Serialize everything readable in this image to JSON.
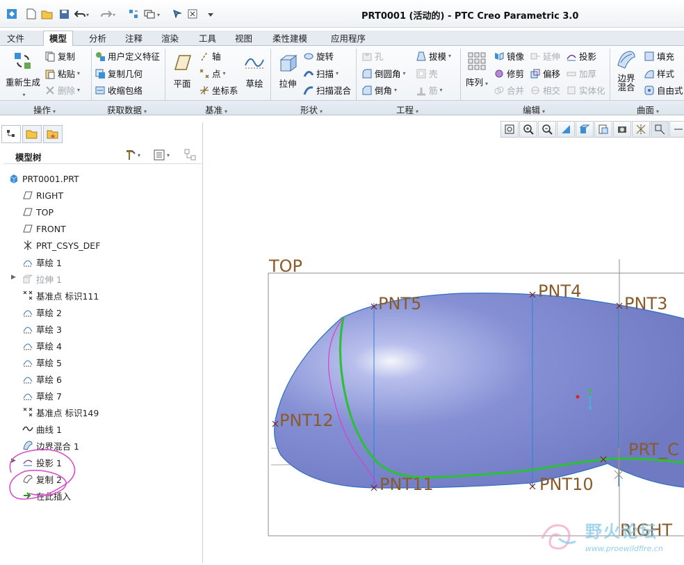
{
  "window": {
    "title": "PRT0001 (活动的) - PTC Creo Parametric 3.0"
  },
  "tabs": [
    {
      "label": "文件"
    },
    {
      "label": "模型"
    },
    {
      "label": "分析"
    },
    {
      "label": "注释"
    },
    {
      "label": "渲染"
    },
    {
      "label": "工具"
    },
    {
      "label": "视图"
    },
    {
      "label": "柔性建模"
    },
    {
      "label": "应用程序"
    }
  ],
  "ribbon": {
    "regenerate": "重新生成",
    "copy": "复制",
    "paste": "粘贴",
    "delete": "删除",
    "udf": "用户定义特征",
    "copy_geometry": "复制几何",
    "shrinkwrap": "收缩包络",
    "plane": "平面",
    "axis": "轴",
    "point": "点",
    "csys": "坐标系",
    "sketch": "草绘",
    "extrude": "拉伸",
    "revolve": "旋转",
    "sweep": "扫描",
    "swept_blend": "扫描混合",
    "hole": "孔",
    "round": "倒圆角",
    "chamfer": "倒角",
    "draft": "拔模",
    "shell": "壳",
    "rib": "筋",
    "pattern": "阵列",
    "mirror": "镜像",
    "extend": "延伸",
    "project": "投影",
    "trim": "修剪",
    "offset": "偏移",
    "thicken": "加厚",
    "merge": "合并",
    "intersect": "相交",
    "solidify": "实体化",
    "boundary_blend": "边界混合",
    "fill": "填充",
    "style": "样式",
    "freestyle": "自由式"
  },
  "groups": {
    "operations": "操作",
    "get_data": "获取数据",
    "datum": "基准",
    "shapes": "形状",
    "engineering": "工程",
    "editing": "编辑",
    "surfaces": "曲面"
  },
  "tree": {
    "title": "模型树",
    "items": [
      {
        "label": "PRT0001.PRT",
        "icon": "part-icon"
      },
      {
        "label": "RIGHT",
        "icon": "datum-plane-icon"
      },
      {
        "label": "TOP",
        "icon": "datum-plane-icon"
      },
      {
        "label": "FRONT",
        "icon": "datum-plane-icon"
      },
      {
        "label": "PRT_CSYS_DEF",
        "icon": "csys-icon"
      },
      {
        "label": "草绘 1",
        "icon": "sketch-icon"
      },
      {
        "label": "拉伸 1",
        "icon": "extrude-icon"
      },
      {
        "label": "基准点 标识111",
        "icon": "datum-point-icon"
      },
      {
        "label": "草绘 2",
        "icon": "sketch-icon"
      },
      {
        "label": "草绘 3",
        "icon": "sketch-icon"
      },
      {
        "label": "草绘 4",
        "icon": "sketch-icon"
      },
      {
        "label": "草绘 5",
        "icon": "sketch-icon"
      },
      {
        "label": "草绘 6",
        "icon": "sketch-icon"
      },
      {
        "label": "草绘 7",
        "icon": "sketch-icon"
      },
      {
        "label": "基准点 标识149",
        "icon": "datum-point-icon"
      },
      {
        "label": "曲线 1",
        "icon": "curve-icon"
      },
      {
        "label": "边界混合 1",
        "icon": "boundary-blend-icon"
      },
      {
        "label": "投影 1",
        "icon": "projection-icon"
      },
      {
        "label": "复制 2",
        "icon": "copy-icon"
      },
      {
        "label": "在此插入",
        "icon": "insert-here-icon"
      }
    ]
  },
  "graphics": {
    "labels": {
      "top": "TOP",
      "right": "RIGHT",
      "csys": "PRT_C",
      "pnt3": "PNT3",
      "pnt4": "PNT4",
      "pnt5": "PNT5",
      "pnt10": "PNT10",
      "pnt11": "PNT11",
      "pnt12": "PNT12"
    }
  },
  "watermark": {
    "title": "野火论坛",
    "url": "www.proewildfire.cn"
  },
  "colors": {
    "surface": "#8a94d8",
    "curve_green": "#2ebf3a",
    "curve_magenta": "#d63fd0",
    "label_brown": "#8b5a2b",
    "annotation_magenta": "#d84fc9"
  }
}
